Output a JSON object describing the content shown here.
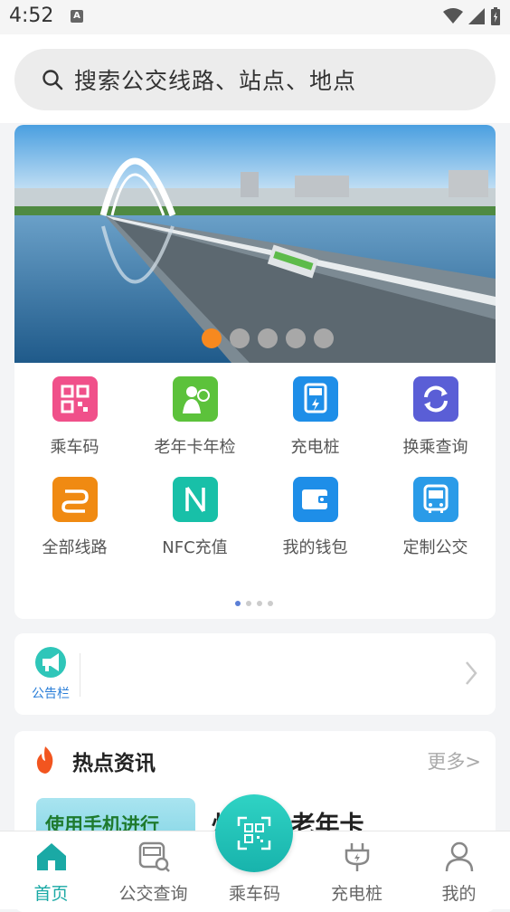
{
  "status": {
    "time": "4:52",
    "notif": "A"
  },
  "search": {
    "placeholder": "搜索公交线路、站点、地点"
  },
  "banner": {
    "dots": 5,
    "active": 0
  },
  "grid": [
    {
      "label": "乘车码",
      "icon": "qr-code-icon",
      "color": "#f0508a"
    },
    {
      "label": "老年卡年检",
      "icon": "elderly-card-icon",
      "color": "#5cc23b"
    },
    {
      "label": "充电桩",
      "icon": "charging-pile-icon",
      "color": "#1e8ee8"
    },
    {
      "label": "换乘查询",
      "icon": "transfer-icon",
      "color": "#5a5ed6"
    },
    {
      "label": "全部线路",
      "icon": "all-routes-icon",
      "color": "#f08a12"
    },
    {
      "label": "NFC充值",
      "icon": "nfc-icon",
      "color": "#18c0a8"
    },
    {
      "label": "我的钱包",
      "icon": "wallet-icon",
      "color": "#1e8ee8"
    },
    {
      "label": "定制公交",
      "icon": "custom-bus-icon",
      "color": "#2a9be8"
    }
  ],
  "notice": {
    "label": "公告栏"
  },
  "news": {
    "title": "热点资讯",
    "more": "更多>",
    "thumb_text": "使用手机进行",
    "headline": "州APP老年卡"
  },
  "tabs": [
    {
      "label": "首页",
      "active": true
    },
    {
      "label": "公交查询",
      "active": false
    },
    {
      "label": "乘车码",
      "active": false
    },
    {
      "label": "充电桩",
      "active": false
    },
    {
      "label": "我的",
      "active": false
    }
  ],
  "colors": {
    "accent": "#1aa9a5",
    "dot_active": "#f7891f"
  }
}
